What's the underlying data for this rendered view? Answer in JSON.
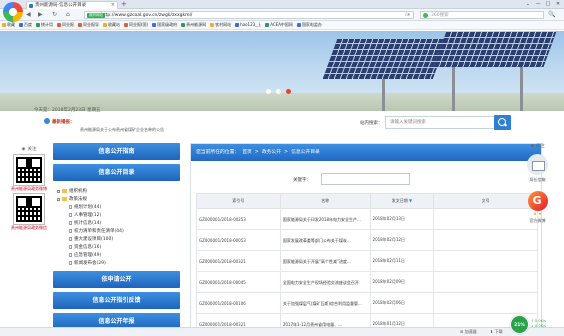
{
  "browser": {
    "tab_title": "贵州能源局-信息公开目录",
    "tab_close": "×",
    "new_tab": "+",
    "window_controls": [
      "⌄",
      "—",
      "□",
      "✕"
    ],
    "nav": [
      "◀",
      "▶",
      "↻",
      "⌂"
    ],
    "url_badge": "政府网站",
    "url": "http://www.gzcoal.gov.cn/zwgk/zxxgkml/",
    "search_placeholder": "360搜索",
    "star": "☆",
    "search_go": "🔍"
  },
  "bookmarks": [
    {
      "label": "收藏",
      "color": "#f2b01e"
    },
    {
      "label": "百度",
      "color": "#3b6fe0"
    },
    {
      "label": "统计用",
      "color": "#2a9d5b"
    },
    {
      "label": "同业报",
      "color": "#e45c3a"
    },
    {
      "label": "同业报导",
      "color": "#e45c3a"
    },
    {
      "label": "收藏站",
      "color": "#f2b01e"
    },
    {
      "label": "同业报(国)",
      "color": "#e45c3a"
    },
    {
      "label": "国家级政府",
      "color": "#3b6fe0"
    },
    {
      "label": "贵州能源网",
      "color": "#2a9d5b"
    },
    {
      "label": "农村网站",
      "color": "#f2b01e"
    },
    {
      "label": "hao123_上",
      "color": "#3b6fe0"
    },
    {
      "label": "ACEA中国网",
      "color": "#2a9d5b"
    },
    {
      "label": "国家电监办",
      "color": "#3b6fe0"
    }
  ],
  "header": {
    "date": "今天是：2018年2月23日 星期五",
    "ticker_heading": "最新播报：",
    "ticker_text": "贵州能源局关于公布贵州省煤矿企业名单的公告"
  },
  "site_search": {
    "label": "站内搜索：",
    "placeholder": "请输入关键词搜索"
  },
  "left_focus": {
    "heading": "关注",
    "qr1_label": "贵州能源局政务微博",
    "qr2_label": "贵州能源局政务微信"
  },
  "left_menu": {
    "buttons_top": [
      "信息公开指南",
      "信息公开目录"
    ],
    "tree": [
      {
        "label": "组织机构",
        "level": 0
      },
      {
        "label": "政策法规",
        "level": 0
      },
      {
        "label": "规划计划(44)",
        "level": 1
      },
      {
        "label": "人事管理(12)",
        "level": 1
      },
      {
        "label": "统计信息(14)",
        "level": 1
      },
      {
        "label": "权力清单和责任清单(44)",
        "level": 1
      },
      {
        "label": "重大建设项目(100)",
        "level": 1
      },
      {
        "label": "资金信息(16)",
        "level": 1
      },
      {
        "label": "应急管理(49)",
        "level": 1
      },
      {
        "label": "新闻发布会(29)",
        "level": 1
      }
    ],
    "buttons_bottom": [
      "依申请公开",
      "信息公开指引反馈",
      "信息公开年报"
    ]
  },
  "main": {
    "breadcrumb_prefix": "您当前所在的位置：",
    "breadcrumb": [
      "首页",
      "政务公开",
      "信息公开目录"
    ],
    "crumb_sep": ">",
    "keyword_label": "关键字：",
    "columns": [
      "索引号",
      "名称",
      "发文日期",
      "文号"
    ],
    "rows": [
      {
        "index": "GZ000001/2018-00253",
        "title": "国家能源局关于印发2018年电力安全生产...",
        "date": "2018年02月13日",
        "doc": ""
      },
      {
        "index": "GZ000001/2018-00053",
        "title": "国家发展改革委等部门公布关于煤炭...",
        "date": "2018年02月12日",
        "doc": ""
      },
      {
        "index": "GZ000001/2018-00321",
        "title": "国家能源局关于开展“高个性减”进度...",
        "date": "2018年02月11日",
        "doc": ""
      },
      {
        "index": "GZ000001/2018-00045",
        "title": "全国电力安全生产现场经验交流座谈会召开",
        "date": "2018年02月09日",
        "doc": ""
      },
      {
        "index": "GZ000001/2018-00106",
        "title": "关于加强煤层气(煤矿瓦斯)综合利用监督管...",
        "date": "2018年02月06日",
        "doc": ""
      },
      {
        "index": "GZ000001/2018-00321",
        "title": "2017年1-12月贵州省用电量、...",
        "date": "2018年01月12日",
        "doc": ""
      }
    ]
  },
  "right_focus": {
    "heading": "关注",
    "email_label": "局长信箱",
    "weibo_label": "官方微博",
    "weibo_stars": "★ ★"
  },
  "statusbar": {
    "left": "",
    "r1": "⊞ 加速器",
    "r2": "⬇ 下载",
    "speed": "21%",
    "net_up": "↑ 0.0K/s",
    "net_down": "↓ 0.0K/s"
  }
}
